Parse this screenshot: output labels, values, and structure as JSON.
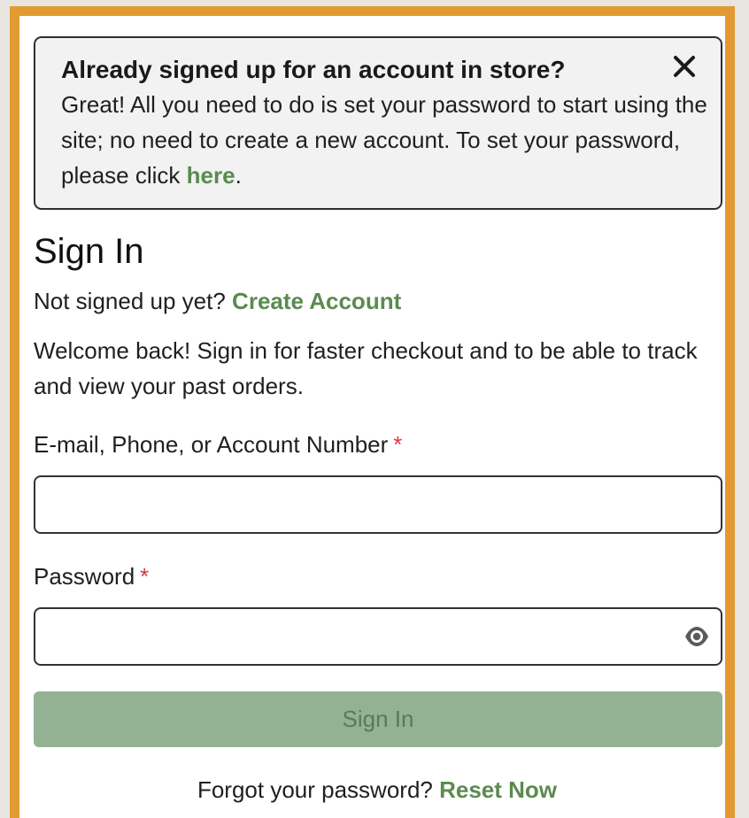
{
  "notice": {
    "title": "Already signed up for an account in store?",
    "body": "Great! All you need to do is set your password to start using the site; no need to create a new account. To set your password, please click",
    "link": "here",
    "period": ".",
    "close_icon": "close-icon"
  },
  "signin": {
    "heading": "Sign In",
    "not_signed_prompt": "Not signed up yet?",
    "create_account_link": "Create Account",
    "welcome_text": "Welcome back! Sign in for faster checkout and to be able to track and view your past orders.",
    "identifier_label": "E-mail, Phone, or Account Number",
    "identifier_value": "",
    "password_label": "Password",
    "password_value": "",
    "required_marker": "*",
    "show_password_icon": "eye-icon",
    "submit_label": "Sign In",
    "forgot_prompt": "Forgot your password?",
    "reset_link": "Reset Now"
  },
  "colors": {
    "frame": "#e29b32",
    "link_green": "#5a8b4f",
    "button_bg": "#93b293",
    "required_red": "#d9363e"
  }
}
